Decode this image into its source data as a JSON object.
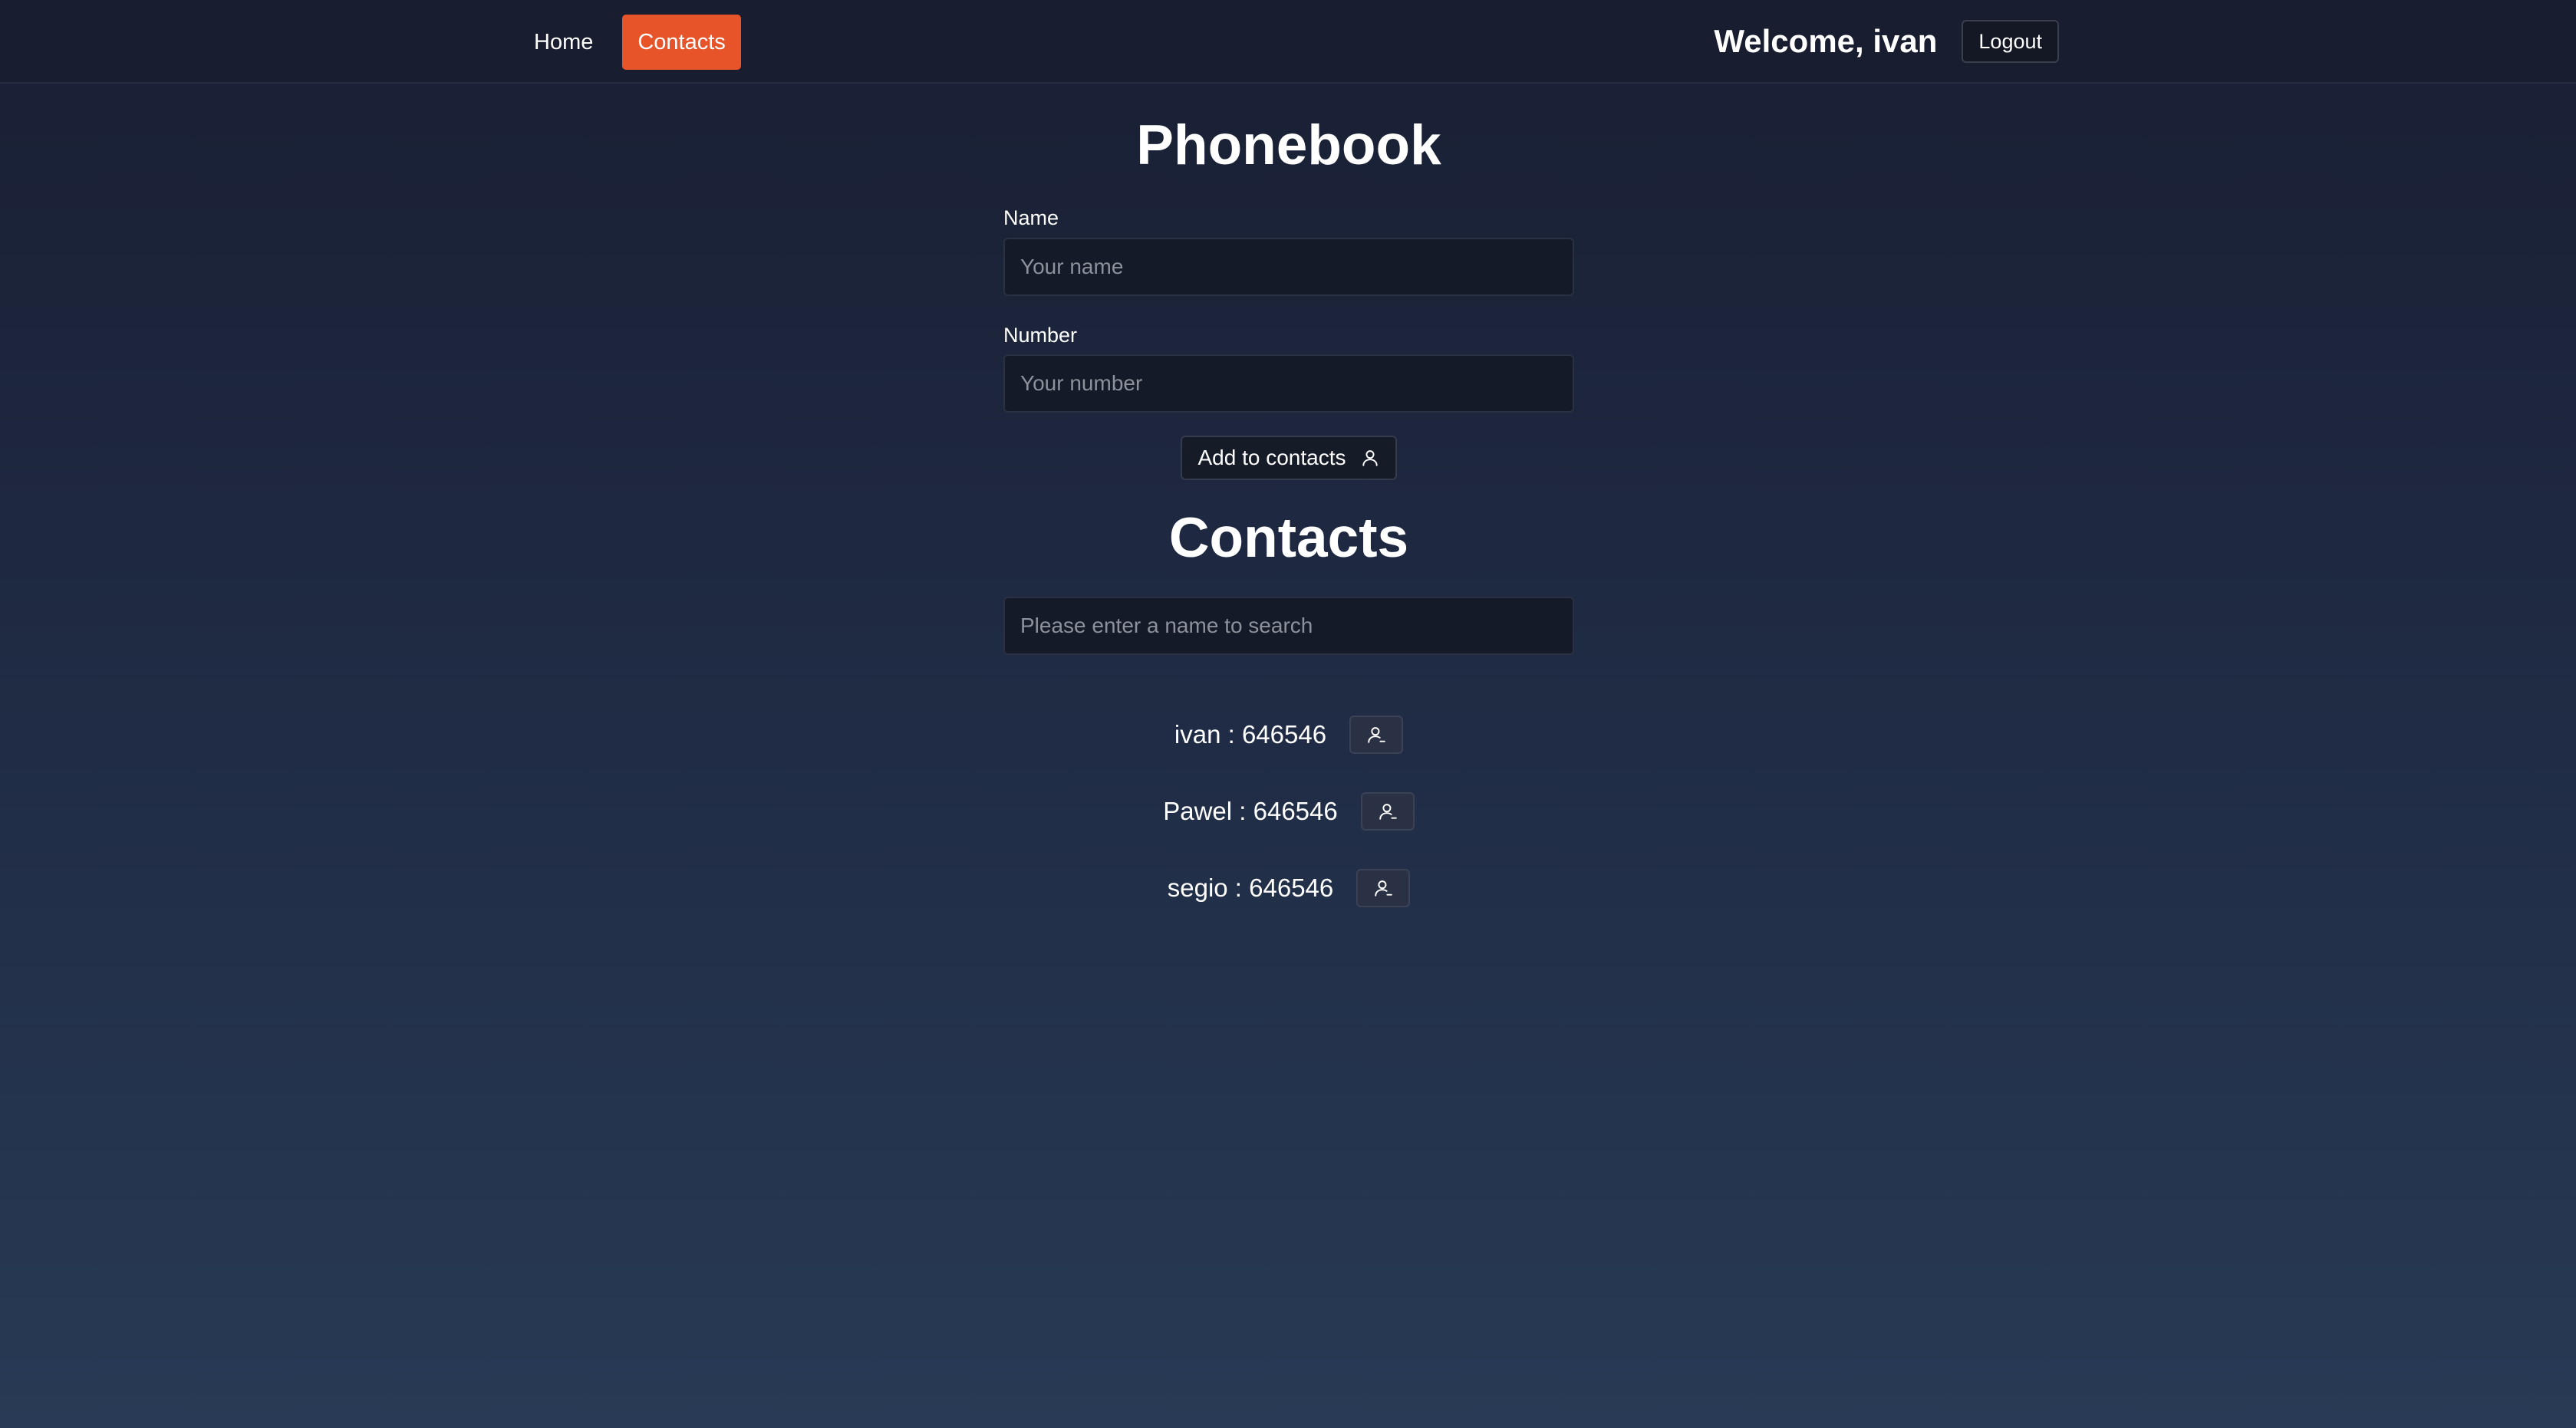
{
  "nav": {
    "items": [
      {
        "label": "Home",
        "active": false
      },
      {
        "label": "Contacts",
        "active": true
      }
    ],
    "active_color": "#e8542a"
  },
  "header": {
    "welcome_text": "Welcome, ivan",
    "logout_label": "Logout"
  },
  "phonebook": {
    "title": "Phonebook",
    "name_label": "Name",
    "name_placeholder": "Your name",
    "name_value": "",
    "number_label": "Number",
    "number_placeholder": "Your number",
    "number_value": "",
    "add_button_label": "Add to contacts",
    "add_button_icon": "user-icon"
  },
  "contacts": {
    "title": "Contacts",
    "search_placeholder": "Please enter a name to search",
    "search_value": "",
    "items": [
      {
        "text": "ivan : 646546",
        "action_icon": "user-remove-icon"
      },
      {
        "text": "Pawel : 646546",
        "action_icon": "user-remove-icon"
      },
      {
        "text": "segio : 646546",
        "action_icon": "user-remove-icon"
      }
    ]
  }
}
